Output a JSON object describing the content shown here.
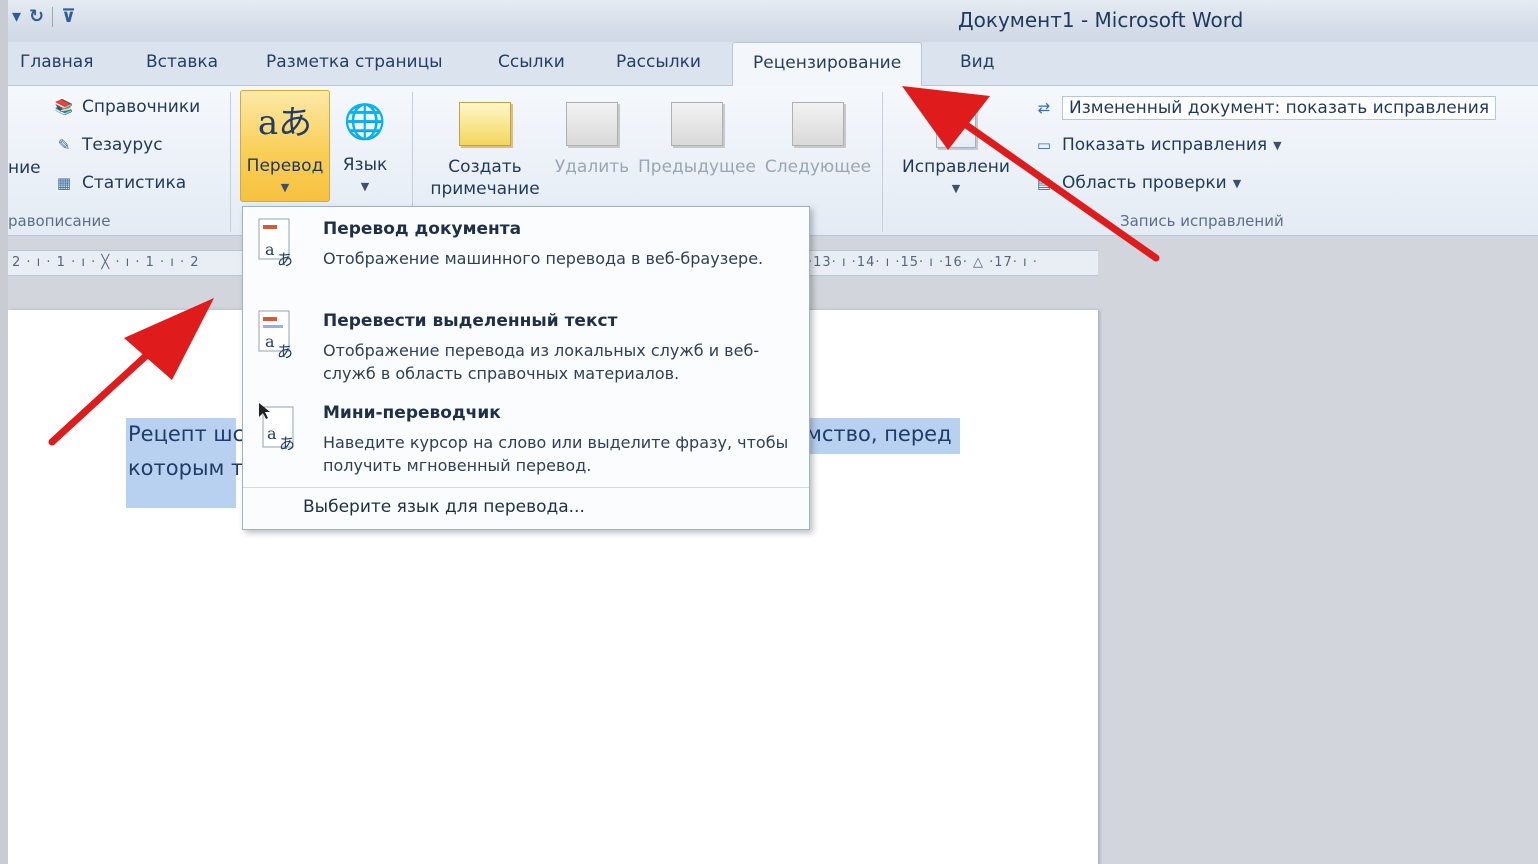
{
  "window": {
    "title": "Документ1  -  Microsoft Word",
    "qat": [
      "▾",
      "↻",
      "|",
      "⊽"
    ]
  },
  "tabs": [
    {
      "label": "Главная"
    },
    {
      "label": "Вставка"
    },
    {
      "label": "Разметка страницы"
    },
    {
      "label": "Ссылки"
    },
    {
      "label": "Рассылки"
    },
    {
      "label": "Рецензирование"
    },
    {
      "label": "Вид"
    }
  ],
  "ribbon": {
    "proofing": {
      "partial_label": "ние",
      "items": [
        "Справочники",
        "Тезаурус",
        "Статистика"
      ],
      "group_label": "равописание"
    },
    "language": {
      "translate_label": "Перевод",
      "language_label": "Язык"
    },
    "comments": {
      "create_label": "Создать\nпримечание",
      "delete_label": "Удалить",
      "prev_label": "Предыдущее",
      "next_label": "Следующее"
    },
    "tracking": {
      "track_label": "Исправлени",
      "display_select": "Измененный документ: показать исправления",
      "show_markup": "Показать исправления",
      "review_pane": "Область проверки",
      "group_label": "Запись исправлений"
    }
  },
  "ruler": {
    "left_text": "2 · ı · 1 · ı ·  ╳  · ı · 1 · ı · 2",
    "right_text": "·13· ı ·14· ı ·15· ı ·16· △ ·17· ı ·"
  },
  "document": {
    "line1_left": "Рецепт шс",
    "line1_right": "мство, перед",
    "line2_left": "которым т"
  },
  "translate_menu": {
    "items": [
      {
        "title": "Перевод документа",
        "desc": "Отображение машинного перевода в веб-браузере."
      },
      {
        "title": "Перевести выделенный текст",
        "desc": "Отображение перевода из локальных служб и веб-служб в область справочных материалов."
      },
      {
        "title": "Мини-переводчик",
        "desc": "Наведите курсор на слово или выделите фразу, чтобы получить мгновенный перевод."
      }
    ],
    "footer": "Выберите язык для перевода..."
  },
  "colors": {
    "arrow": "#e01b1b",
    "highlight": "#f9cf57",
    "selection": "#b8d1f0"
  }
}
